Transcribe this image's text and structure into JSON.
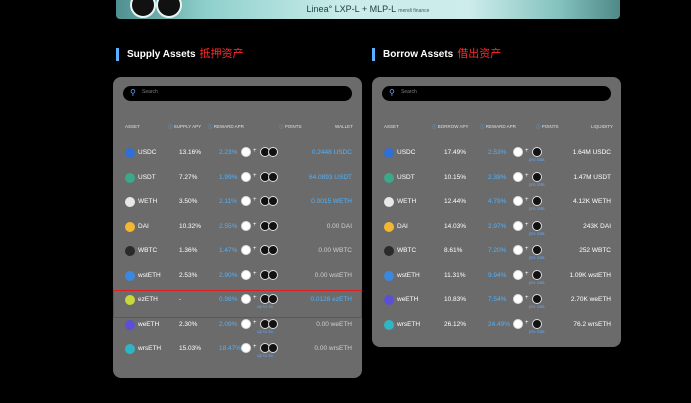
{
  "banner": {
    "text": "Linea° LXP-L + MLP-L",
    "sub": "mendi finance"
  },
  "supply": {
    "title": "Supply Assets",
    "title_zh": "抵押资产",
    "search_placeholder": "Search",
    "headers": {
      "asset": "ASSET",
      "apy": "SUPPLY APY",
      "reward": "REWARD APR",
      "points": "POINTS",
      "wallet": "WALLET"
    },
    "rows": [
      {
        "asset": "USDC",
        "apy": "13.16%",
        "reward": "2.23%",
        "wallet": "0.2448 USDC",
        "wallet_blue": true,
        "sub": ""
      },
      {
        "asset": "USDT",
        "apy": "7.27%",
        "reward": "1.99%",
        "wallet": "64.0893 USDT",
        "wallet_blue": true,
        "sub": ""
      },
      {
        "asset": "WETH",
        "apy": "3.50%",
        "reward": "2.11%",
        "wallet": "0.0015 WETH",
        "wallet_blue": true,
        "sub": ""
      },
      {
        "asset": "DAI",
        "apy": "10.32%",
        "reward": "2.55%",
        "wallet": "0.00 DAI",
        "wallet_blue": false,
        "sub": ""
      },
      {
        "asset": "WBTC",
        "apy": "1.36%",
        "reward": "1.47%",
        "wallet": "0.00 WBTC",
        "wallet_blue": false,
        "sub": ""
      },
      {
        "asset": "wstETH",
        "apy": "2.53%",
        "reward": "2.90%",
        "wallet": "0.00 wstETH",
        "wallet_blue": false,
        "sub": ""
      },
      {
        "asset": "ezETH",
        "apy": "-",
        "reward": "0.98%",
        "wallet": "0.0128 ezETH",
        "wallet_blue": true,
        "sub": "up to 4x"
      },
      {
        "asset": "weETH",
        "apy": "2.30%",
        "reward": "2.09%",
        "wallet": "0.00 weETH",
        "wallet_blue": false,
        "sub": "up to 4x"
      },
      {
        "asset": "wrsETH",
        "apy": "15.03%",
        "reward": "18.47%",
        "wallet": "0.00 wrsETH",
        "wallet_blue": false,
        "sub": "up to 4x"
      }
    ]
  },
  "borrow": {
    "title": "Borrow Assets",
    "title_zh": "借出资产",
    "search_placeholder": "Search",
    "headers": {
      "asset": "ASSET",
      "apy": "BORROW APY",
      "reward": "REWARD APR",
      "points": "POINTS",
      "liquidity": "LIQUIDITY"
    },
    "rows": [
      {
        "asset": "USDC",
        "apy": "17.49%",
        "reward": "2.53%",
        "liquidity": "1.64M USDC",
        "sub": "pro rata"
      },
      {
        "asset": "USDT",
        "apy": "10.15%",
        "reward": "2.38%",
        "liquidity": "1.47M USDT",
        "sub": "pro rata"
      },
      {
        "asset": "WETH",
        "apy": "12.44%",
        "reward": "4.79%",
        "liquidity": "4.12K WETH",
        "sub": "pro rata"
      },
      {
        "asset": "DAI",
        "apy": "14.03%",
        "reward": "2.97%",
        "liquidity": "243K DAI",
        "sub": "pro rata"
      },
      {
        "asset": "WBTC",
        "apy": "8.61%",
        "reward": "7.20%",
        "liquidity": "252 WBTC",
        "sub": "pro rata"
      },
      {
        "asset": "wstETH",
        "apy": "11.31%",
        "reward": "9.94%",
        "liquidity": "1.09K wstETH",
        "sub": "pro rata"
      },
      {
        "asset": "weETH",
        "apy": "10.83%",
        "reward": "7.54%",
        "liquidity": "2.70K weETH",
        "sub": "pro rata"
      },
      {
        "asset": "wrsETH",
        "apy": "26.12%",
        "reward": "24.49%",
        "liquidity": "76.2 wrsETH",
        "sub": "pro rata"
      }
    ]
  },
  "asset_colors": {
    "USDC": "#2f6fd6",
    "USDT": "#3aa889",
    "WETH": "#e8e8e8",
    "DAI": "#f4b731",
    "WBTC": "#2a2a2a",
    "wstETH": "#3a88e0",
    "ezETH": "#c9d73a",
    "weETH": "#5b4fd8",
    "wrsETH": "#2fb6c4"
  }
}
